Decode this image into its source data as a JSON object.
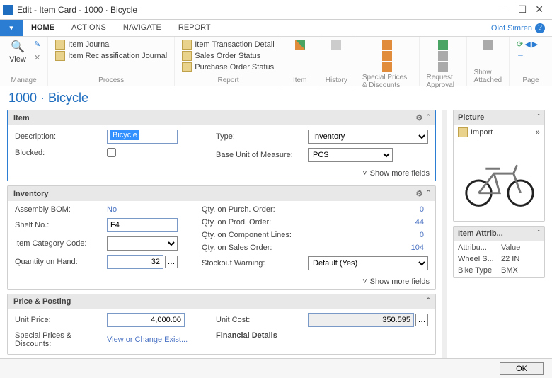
{
  "window": {
    "title": "Edit - Item Card - 1000 · Bicycle"
  },
  "tabs": {
    "home": "HOME",
    "actions": "ACTIONS",
    "navigate": "NAVIGATE",
    "report": "REPORT",
    "user": "Olof Simren"
  },
  "ribbon": {
    "manage": {
      "view": "View",
      "label": "Manage"
    },
    "process": {
      "journal": "Item Journal",
      "reclass": "Item Reclassification Journal",
      "label": "Process"
    },
    "report": {
      "trans": "Item Transaction Detail",
      "sales": "Sales Order Status",
      "purchase": "Purchase Order Status",
      "label": "Report"
    },
    "item": "Item",
    "history": "History",
    "prices": "Special Prices & Discounts",
    "approval": "Request Approval",
    "attached": "Show Attached",
    "page": "Page"
  },
  "page": {
    "title": "1000 · Bicycle",
    "showmore": "Show more fields"
  },
  "item_fasttab": {
    "title": "Item",
    "description_label": "Description:",
    "description_value": "Bicycle",
    "blocked_label": "Blocked:",
    "type_label": "Type:",
    "type_value": "Inventory",
    "baseuom_label": "Base Unit of Measure:",
    "baseuom_value": "PCS"
  },
  "inventory_fasttab": {
    "title": "Inventory",
    "assembly_bom_label": "Assembly BOM:",
    "assembly_bom_value": "No",
    "shelf_label": "Shelf No.:",
    "shelf_value": "F4",
    "category_label": "Item Category Code:",
    "category_value": "",
    "qty_hand_label": "Quantity on Hand:",
    "qty_hand_value": "32",
    "qty_purch_label": "Qty. on Purch. Order:",
    "qty_purch_value": "0",
    "qty_prod_label": "Qty. on Prod. Order:",
    "qty_prod_value": "44",
    "qty_comp_label": "Qty. on Component Lines:",
    "qty_comp_value": "0",
    "qty_sales_label": "Qty. on Sales Order:",
    "qty_sales_value": "104",
    "stockout_label": "Stockout Warning:",
    "stockout_value": "Default (Yes)"
  },
  "price_fasttab": {
    "title": "Price & Posting",
    "unitprice_label": "Unit Price:",
    "unitprice_value": "4,000.00",
    "special_label": "Special Prices & Discounts:",
    "special_value": "View or Change Exist...",
    "unitcost_label": "Unit Cost:",
    "unitcost_value": "350.595",
    "financial_label": "Financial Details"
  },
  "picture_panel": {
    "title": "Picture",
    "import": "Import"
  },
  "attrib_panel": {
    "title": "Item Attrib...",
    "col1": "Attribu...",
    "col2": "Value",
    "rows": [
      {
        "k": "Wheel S...",
        "v": "22 IN"
      },
      {
        "k": "Bike Type",
        "v": "BMX"
      }
    ]
  },
  "footer": {
    "ok": "OK"
  }
}
